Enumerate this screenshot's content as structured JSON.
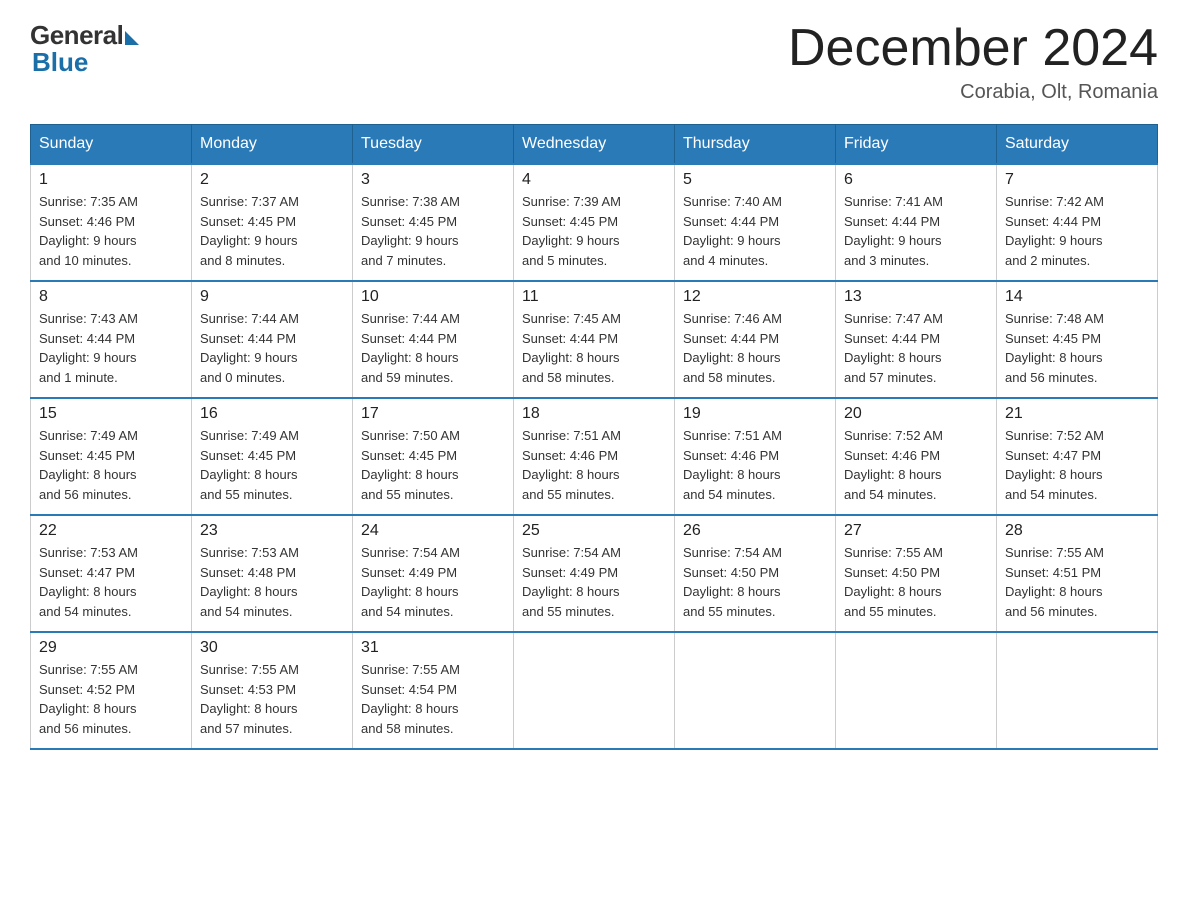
{
  "logo": {
    "general": "General",
    "blue": "Blue"
  },
  "title": "December 2024",
  "location": "Corabia, Olt, Romania",
  "days_of_week": [
    "Sunday",
    "Monday",
    "Tuesday",
    "Wednesday",
    "Thursday",
    "Friday",
    "Saturday"
  ],
  "weeks": [
    [
      {
        "day": "1",
        "sunrise": "7:35 AM",
        "sunset": "4:46 PM",
        "daylight": "9 hours and 10 minutes."
      },
      {
        "day": "2",
        "sunrise": "7:37 AM",
        "sunset": "4:45 PM",
        "daylight": "9 hours and 8 minutes."
      },
      {
        "day": "3",
        "sunrise": "7:38 AM",
        "sunset": "4:45 PM",
        "daylight": "9 hours and 7 minutes."
      },
      {
        "day": "4",
        "sunrise": "7:39 AM",
        "sunset": "4:45 PM",
        "daylight": "9 hours and 5 minutes."
      },
      {
        "day": "5",
        "sunrise": "7:40 AM",
        "sunset": "4:44 PM",
        "daylight": "9 hours and 4 minutes."
      },
      {
        "day": "6",
        "sunrise": "7:41 AM",
        "sunset": "4:44 PM",
        "daylight": "9 hours and 3 minutes."
      },
      {
        "day": "7",
        "sunrise": "7:42 AM",
        "sunset": "4:44 PM",
        "daylight": "9 hours and 2 minutes."
      }
    ],
    [
      {
        "day": "8",
        "sunrise": "7:43 AM",
        "sunset": "4:44 PM",
        "daylight": "9 hours and 1 minute."
      },
      {
        "day": "9",
        "sunrise": "7:44 AM",
        "sunset": "4:44 PM",
        "daylight": "9 hours and 0 minutes."
      },
      {
        "day": "10",
        "sunrise": "7:44 AM",
        "sunset": "4:44 PM",
        "daylight": "8 hours and 59 minutes."
      },
      {
        "day": "11",
        "sunrise": "7:45 AM",
        "sunset": "4:44 PM",
        "daylight": "8 hours and 58 minutes."
      },
      {
        "day": "12",
        "sunrise": "7:46 AM",
        "sunset": "4:44 PM",
        "daylight": "8 hours and 58 minutes."
      },
      {
        "day": "13",
        "sunrise": "7:47 AM",
        "sunset": "4:44 PM",
        "daylight": "8 hours and 57 minutes."
      },
      {
        "day": "14",
        "sunrise": "7:48 AM",
        "sunset": "4:45 PM",
        "daylight": "8 hours and 56 minutes."
      }
    ],
    [
      {
        "day": "15",
        "sunrise": "7:49 AM",
        "sunset": "4:45 PM",
        "daylight": "8 hours and 56 minutes."
      },
      {
        "day": "16",
        "sunrise": "7:49 AM",
        "sunset": "4:45 PM",
        "daylight": "8 hours and 55 minutes."
      },
      {
        "day": "17",
        "sunrise": "7:50 AM",
        "sunset": "4:45 PM",
        "daylight": "8 hours and 55 minutes."
      },
      {
        "day": "18",
        "sunrise": "7:51 AM",
        "sunset": "4:46 PM",
        "daylight": "8 hours and 55 minutes."
      },
      {
        "day": "19",
        "sunrise": "7:51 AM",
        "sunset": "4:46 PM",
        "daylight": "8 hours and 54 minutes."
      },
      {
        "day": "20",
        "sunrise": "7:52 AM",
        "sunset": "4:46 PM",
        "daylight": "8 hours and 54 minutes."
      },
      {
        "day": "21",
        "sunrise": "7:52 AM",
        "sunset": "4:47 PM",
        "daylight": "8 hours and 54 minutes."
      }
    ],
    [
      {
        "day": "22",
        "sunrise": "7:53 AM",
        "sunset": "4:47 PM",
        "daylight": "8 hours and 54 minutes."
      },
      {
        "day": "23",
        "sunrise": "7:53 AM",
        "sunset": "4:48 PM",
        "daylight": "8 hours and 54 minutes."
      },
      {
        "day": "24",
        "sunrise": "7:54 AM",
        "sunset": "4:49 PM",
        "daylight": "8 hours and 54 minutes."
      },
      {
        "day": "25",
        "sunrise": "7:54 AM",
        "sunset": "4:49 PM",
        "daylight": "8 hours and 55 minutes."
      },
      {
        "day": "26",
        "sunrise": "7:54 AM",
        "sunset": "4:50 PM",
        "daylight": "8 hours and 55 minutes."
      },
      {
        "day": "27",
        "sunrise": "7:55 AM",
        "sunset": "4:50 PM",
        "daylight": "8 hours and 55 minutes."
      },
      {
        "day": "28",
        "sunrise": "7:55 AM",
        "sunset": "4:51 PM",
        "daylight": "8 hours and 56 minutes."
      }
    ],
    [
      {
        "day": "29",
        "sunrise": "7:55 AM",
        "sunset": "4:52 PM",
        "daylight": "8 hours and 56 minutes."
      },
      {
        "day": "30",
        "sunrise": "7:55 AM",
        "sunset": "4:53 PM",
        "daylight": "8 hours and 57 minutes."
      },
      {
        "day": "31",
        "sunrise": "7:55 AM",
        "sunset": "4:54 PM",
        "daylight": "8 hours and 58 minutes."
      },
      null,
      null,
      null,
      null
    ]
  ],
  "labels": {
    "sunrise": "Sunrise:",
    "sunset": "Sunset:",
    "daylight": "Daylight:"
  }
}
